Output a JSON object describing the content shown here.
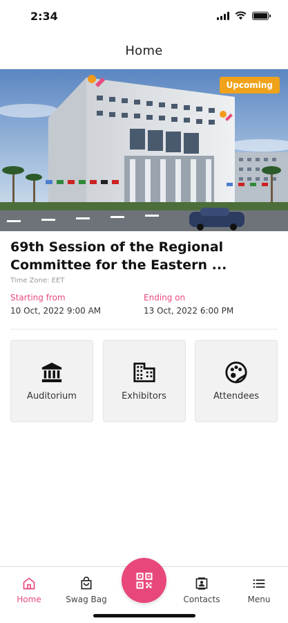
{
  "status_bar": {
    "time": "2:34"
  },
  "header": {
    "title": "Home"
  },
  "event": {
    "status_badge": "Upcoming",
    "title_line1": "69th Session of the Regional",
    "title_line2": "Committee for the Eastern ...",
    "timezone": "Time Zone: EET",
    "start_label": "Starting from",
    "start_value": "10 Oct, 2022   9:00 AM",
    "end_label": "Ending on",
    "end_value": "13 Oct, 2022   6:00 PM"
  },
  "tiles": [
    {
      "label": "Auditorium",
      "icon": "bank-icon"
    },
    {
      "label": "Exhibitors",
      "icon": "building-icon"
    },
    {
      "label": "Attendees",
      "icon": "palette-icon"
    }
  ],
  "nav": {
    "home": "Home",
    "swag_bag": "Swag Bag",
    "contacts": "Contacts",
    "menu": "Menu",
    "center_icon": "qr-code-icon"
  },
  "colors": {
    "accent": "#e84a7f",
    "badge": "#f0a21a",
    "tile_bg": "#f2f2f2"
  }
}
